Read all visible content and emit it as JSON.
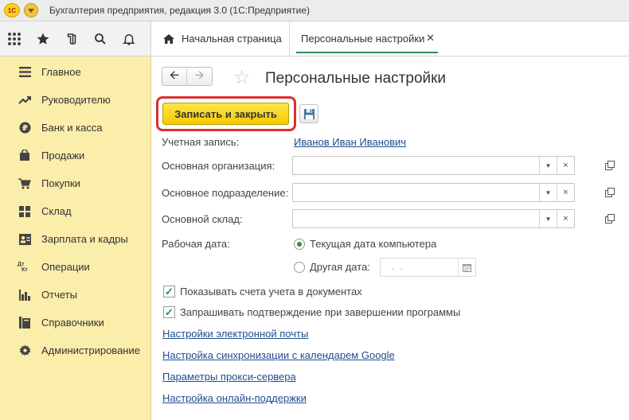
{
  "window": {
    "title": "Бухгалтерия предприятия, редакция 3.0  (1С:Предприятие)",
    "logo_text": "1С"
  },
  "tabs": [
    {
      "label": "Начальная страница",
      "active": false
    },
    {
      "label": "Персональные настройки",
      "active": true
    }
  ],
  "sidebar": {
    "items": [
      {
        "label": "Главное",
        "icon": "menu-lines-icon"
      },
      {
        "label": "Руководителю",
        "icon": "trend-up-icon"
      },
      {
        "label": "Банк и касса",
        "icon": "ruble-coin-icon"
      },
      {
        "label": "Продажи",
        "icon": "shopping-bag-icon"
      },
      {
        "label": "Покупки",
        "icon": "shopping-cart-icon"
      },
      {
        "label": "Склад",
        "icon": "warehouse-grid-icon"
      },
      {
        "label": "Зарплата и кадры",
        "icon": "person-card-icon"
      },
      {
        "label": "Операции",
        "icon": "debit-credit-icon"
      },
      {
        "label": "Отчеты",
        "icon": "bar-chart-icon"
      },
      {
        "label": "Справочники",
        "icon": "books-icon"
      },
      {
        "label": "Администрирование",
        "icon": "gear-icon"
      }
    ],
    "dtkt_text": {
      "dt": "Дт",
      "kt": "Кт"
    }
  },
  "form": {
    "title": "Персональные настройки",
    "save_close_label": "Записать и закрыть",
    "account_label": "Учетная запись:",
    "account_value": "Иванов Иван Иванович",
    "org_label": "Основная организация:",
    "org_value": "",
    "dept_label": "Основное подразделение:",
    "dept_value": "",
    "warehouse_label": "Основной склад:",
    "warehouse_value": "",
    "workdate_label": "Рабочая дата:",
    "workdate_option_current": "Текущая дата компьютера",
    "workdate_option_other": "Другая дата:",
    "workdate_selected": "current",
    "other_date_mask": ". .",
    "show_accounts_label": "Показывать счета учета в документах",
    "show_accounts_checked": true,
    "confirm_exit_label": "Запрашивать подтверждение при завершении программы",
    "confirm_exit_checked": true
  },
  "links": {
    "email": "Настройки электронной почты",
    "google": "Настройка синхронизации с календарем Google",
    "proxy": "Параметры прокси-сервера",
    "support": "Настройка онлайн-поддержки"
  },
  "colors": {
    "sidebar_bg": "#fbedaa",
    "save_button": "#f5cc00",
    "highlight_border": "#d9302f",
    "active_tab_underline": "#2e8b57",
    "link": "#1f4d8f",
    "check": "#2b8f3d"
  }
}
